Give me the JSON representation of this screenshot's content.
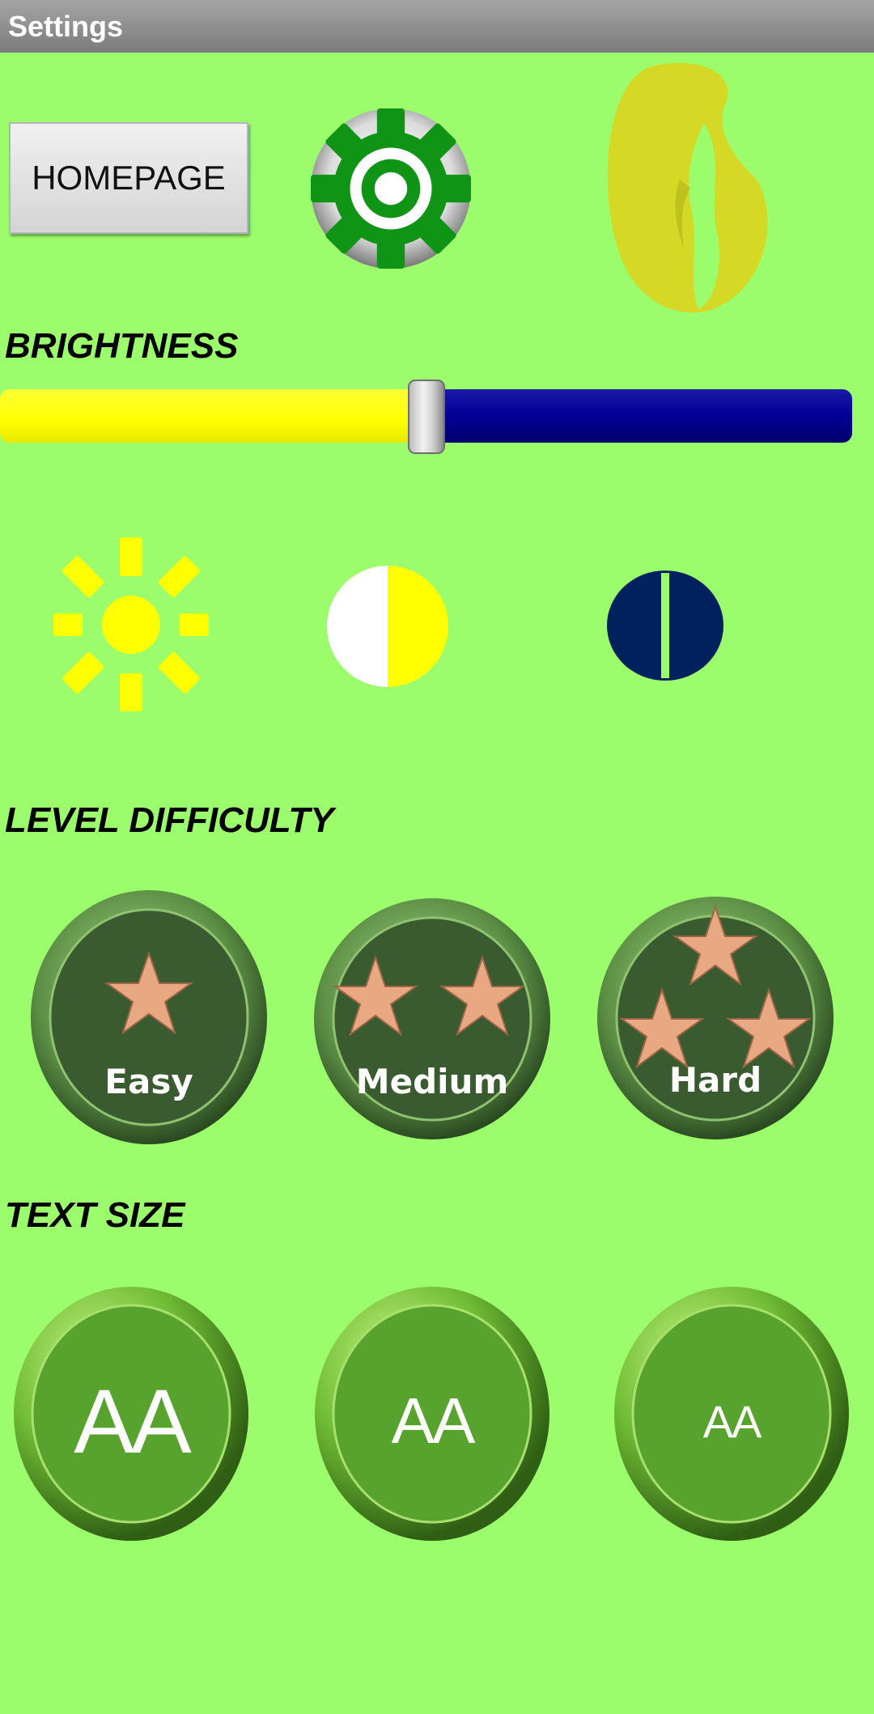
{
  "titlebar": {
    "title": "Settings"
  },
  "header": {
    "home_label": "HOMEPAGE"
  },
  "brightness": {
    "title": "BRIGHTNESS",
    "value_fraction": 0.5,
    "track_min_color": "#ffff00",
    "track_max_color": "#000096"
  },
  "brightness_presets": [
    {
      "name": "sun-icon",
      "color": "#ffff00"
    },
    {
      "name": "half-moon-icon",
      "color": "#ffff00"
    },
    {
      "name": "dark-mode-icon",
      "color": "#00215e"
    }
  ],
  "difficulty": {
    "title": "LEVEL DIFFICULTY",
    "levels": [
      {
        "label": "Easy",
        "stars": 1
      },
      {
        "label": "Medium",
        "stars": 2
      },
      {
        "label": "Hard",
        "stars": 3
      }
    ]
  },
  "text_size": {
    "title": "TEXT SIZE",
    "options": [
      {
        "label": "AA"
      },
      {
        "label": "AA"
      },
      {
        "label": "AA"
      }
    ]
  },
  "colors": {
    "background": "#9cfd6c",
    "button_dark_green": "#3a5a30",
    "button_mid_green": "#57a32d",
    "star_copper": "#e8a882"
  }
}
